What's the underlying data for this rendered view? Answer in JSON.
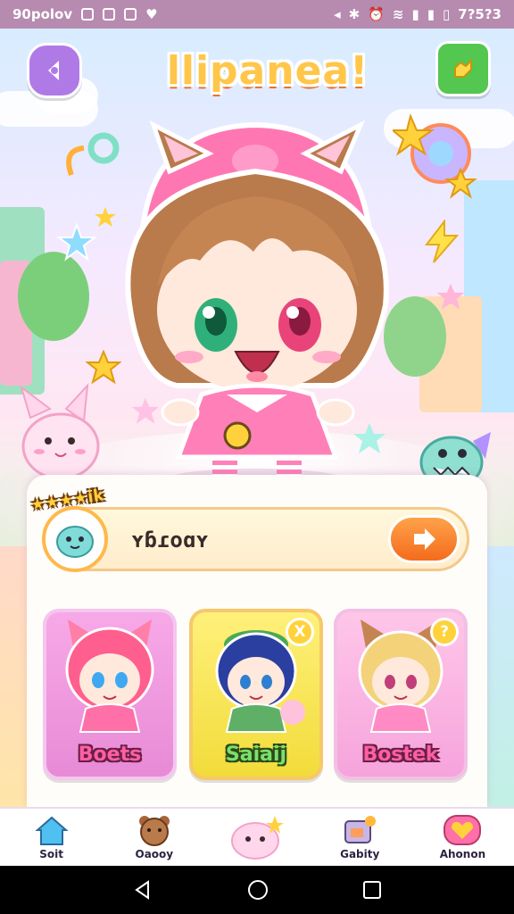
{
  "status_bar": {
    "left_text": "90polov",
    "right_text": "7?5?3"
  },
  "header": {
    "title": "llipanea!",
    "back_button": {
      "icon": "back-icon"
    },
    "settings_button": {
      "icon": "settings-icon"
    }
  },
  "name_bar": {
    "stars_label": "★★★★ik",
    "name_value": "ʏɓɾoɑʏ",
    "confirm_button_icon": "arrow-right-icon"
  },
  "characters": [
    {
      "name": "Boets",
      "badge": ""
    },
    {
      "name": "Saiaij",
      "badge": "X"
    },
    {
      "name": "Bostek",
      "badge": "?"
    }
  ],
  "bottom_nav": [
    {
      "label": "Soit",
      "icon": "home-icon"
    },
    {
      "label": "Oaooy",
      "icon": "bear-icon"
    },
    {
      "label": "",
      "icon": "pet-blob-icon"
    },
    {
      "label": "Gabity",
      "icon": "shop-icon"
    },
    {
      "label": "Ahonon",
      "icon": "heart-icon"
    }
  ],
  "colors": {
    "status_bar": "#b78ab0",
    "accent_orange": "#f36c1c",
    "accent_pink": "#ff5fa4",
    "card_yellow": "#f2dc3b"
  }
}
